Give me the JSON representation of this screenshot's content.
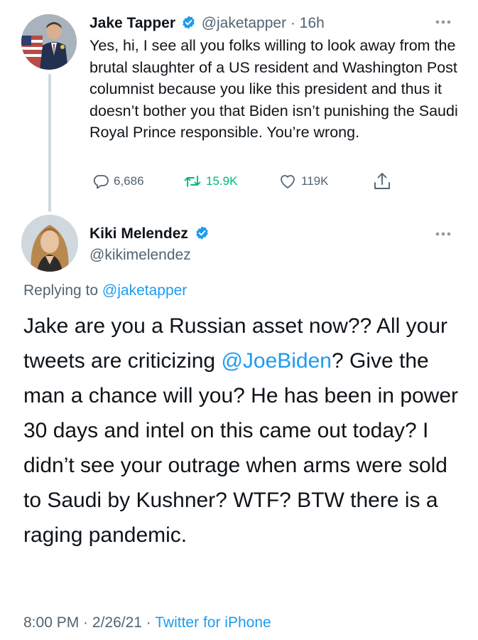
{
  "tweet1": {
    "name": "Jake Tapper",
    "handle": "@jaketapper",
    "time": "16h",
    "text": "Yes, hi, I see all you folks willing to look away from the brutal slaughter of a US resident and Washington Post columnist because you like this president and thus it doesn’t bother you that Biden isn’t punishing the Saudi Royal Prince responsible. You’re wrong.",
    "replies": "6,686",
    "retweets": "15.9K",
    "likes": "119K"
  },
  "tweet2": {
    "name": "Kiki Melendez",
    "handle": "@kikimelendez",
    "replying_prefix": "Replying to ",
    "replying_to": "@jaketapper",
    "text_part1": "Jake are you a Russian asset now?? All your tweets are criticizing ",
    "mention": "@JoeBiden",
    "text_part2": "? Give the man a chance will you? He has been in power 30 days and intel on this came out today? I didn’t see your outrage when arms were sold to Saudi by Kushner? WTF? BTW there is a raging pandemic.",
    "time": "8:00 PM",
    "date": "2/26/21",
    "source": "Twitter for iPhone"
  },
  "colors": {
    "accent": "#1d9bf0",
    "retweet": "#00ba7c",
    "muted": "#536471",
    "text": "#0f1419"
  },
  "icons": [
    "verified-badge-icon",
    "more-icon",
    "reply-icon",
    "retweet-icon",
    "like-icon",
    "share-icon"
  ]
}
